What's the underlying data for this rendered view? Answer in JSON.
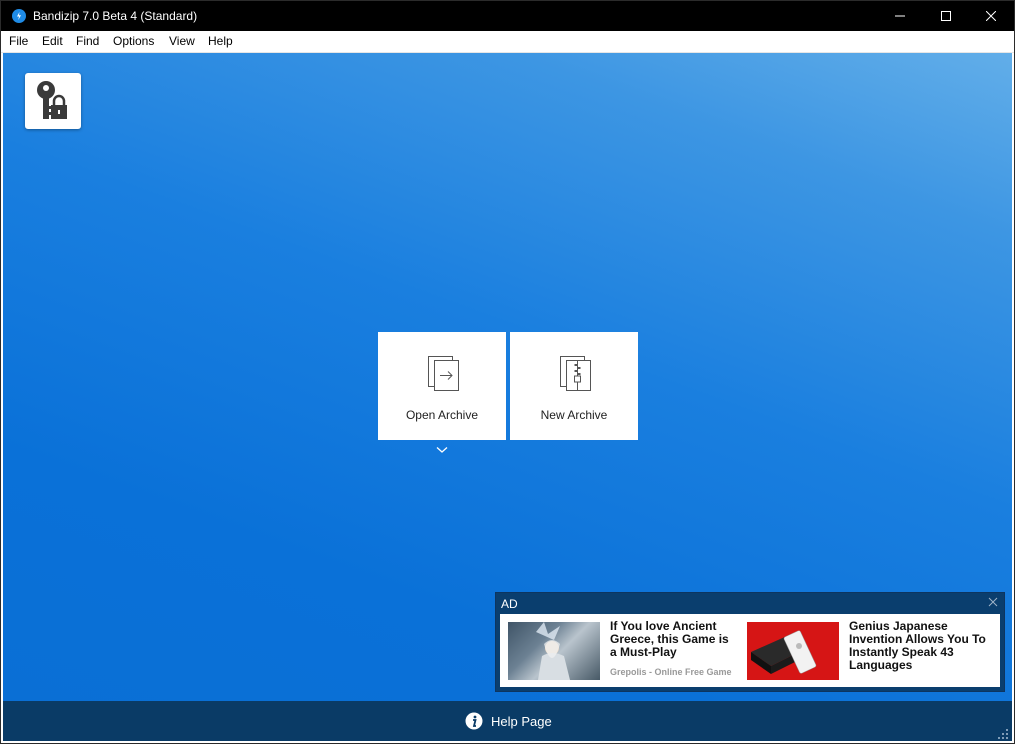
{
  "window": {
    "title": "Bandizip 7.0 Beta 4 (Standard)"
  },
  "menu": {
    "items": [
      "File",
      "Edit",
      "Find",
      "Options",
      "View",
      "Help"
    ]
  },
  "main": {
    "tiles": {
      "open_label": "Open Archive",
      "new_label": "New Archive"
    }
  },
  "ad": {
    "label": "AD",
    "items": [
      {
        "title": "If You love Ancient Greece, this Game is a Must-Play",
        "source": "Grepolis - Online Free Game"
      },
      {
        "title": "Genius Japanese Invention Allows You To Instantly Speak 43 Languages"
      }
    ]
  },
  "footer": {
    "help_label": "Help Page"
  },
  "icons": {
    "app": "bandizip-logo-icon",
    "password": "key-lock-icon",
    "open": "open-archive-icon",
    "new": "new-archive-icon",
    "expand": "chevron-down-icon",
    "info": "info-icon",
    "close": "close-icon"
  },
  "colors": {
    "background_top": "#62aee9",
    "background_bottom": "#0a6fd5",
    "footer": "#0a3b66",
    "ad_panel": "#0a3e6e",
    "titlebar": "#000000"
  }
}
